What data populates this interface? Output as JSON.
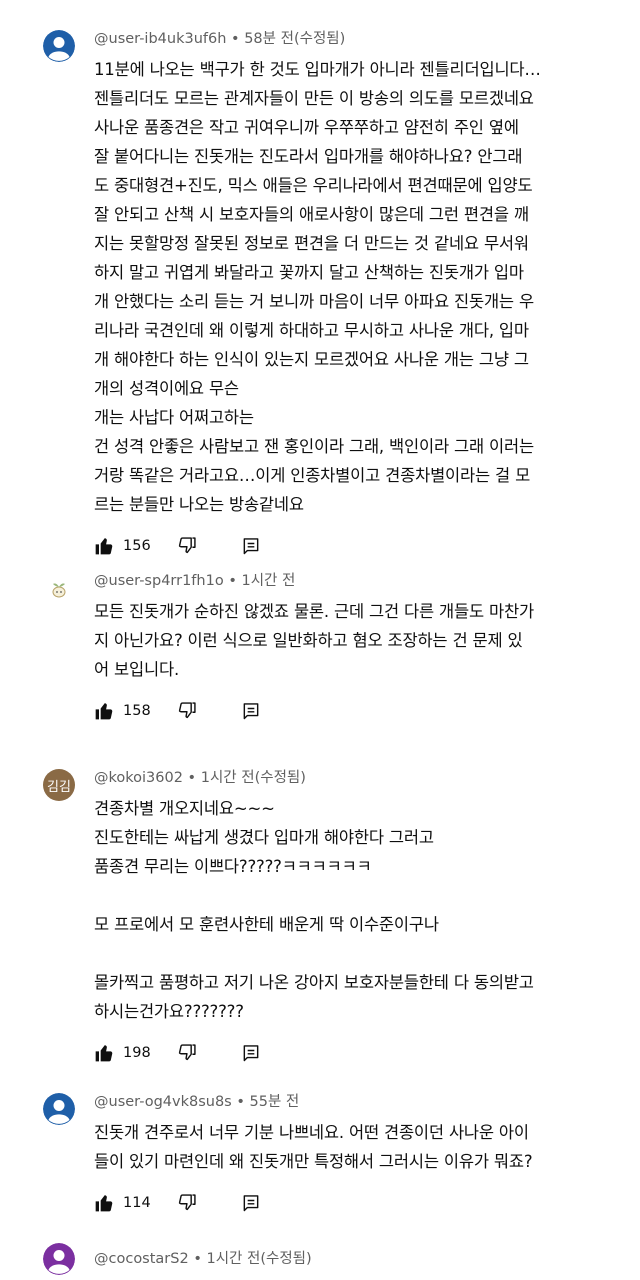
{
  "comments": [
    {
      "author": "@user-ib4uk3uf6h",
      "time": "58분 전(수정됨)",
      "avatar": "default-avatar-icon",
      "lines": [
        "11분에 나오는 백구가 한 것도 입마개가 아니라 젠틀리더입니다…",
        "젠틀리더도 모르는 관계자들이 만든 이 방송의 의도를 모르겠네요",
        "사나운 품종견은 작고 귀여우니까 우쭈쭈하고 얌전히 주인 옆에",
        "잘 붙어다니는 진돗개는 진도라서 입마개를 해야하나요? 안그래",
        "도 중대형견+진도, 믹스 애들은 우리나라에서 편견때문에 입양도",
        "잘 안되고 산책 시 보호자들의 애로사항이 많은데 그런 편견을 깨",
        "지는 못할망정 잘못된 정보로 편견을 더 만드는 것 같네요 무서워",
        "하지 말고 귀엽게 봐달라고 꽃까지 달고 산책하는 진돗개가 입마",
        "개 안했다는 소리 듣는 거 보니까 마음이 너무 아파요 진돗개는 우",
        "리나라 국견인데 왜 이렇게 하대하고 무시하고 사나운 개다, 입마",
        "개 해야한다 하는 인식이 있는지 모르겠어요 사나운 개는 그냥 그",
        "개의 성격이에요 무슨",
        "개는 사납다 어쩌고하는",
        "건 성격 안좋은 사람보고 잰 홍인이라 그래, 백인이라 그래 이러는",
        "거랑 똑같은 거라고요…이게 인종차별이고 견종차별이라는 걸 모",
        "르는 분들만 나오는 방송같네요"
      ],
      "likes": "156"
    },
    {
      "author": "@user-sp4rr1fh1o",
      "time": "1시간 전",
      "avatar": "sprout-avatar-icon",
      "lines": [
        "모든 진돗개가 순하진 않겠죠 물론. 근데 그건 다른 개들도 마찬가",
        "지 아닌가요? 이런 식으로 일반화하고 혐오 조장하는 건 문제 있",
        "어 보입니다."
      ],
      "likes": "158"
    },
    {
      "author": "@kokoi3602",
      "time": "1시간 전(수정됨)",
      "avatar_text": "김김",
      "avatar_color": "#8a6a45",
      "lines": [
        "견종차별 개오지네요~~~",
        "진도한테는 싸납게 생겼다 입마개 해야한다 그러고",
        "품종견 무리는 이쁘다?????ㅋㅋㅋㅋㅋㅋ",
        "",
        "모 프로에서 모 훈련사한테 배운게 딱 이수준이구나",
        "",
        "몰카찍고 품평하고 저기 나온 강아지 보호자분들한테 다 동의받고",
        "하시는건가요???????"
      ],
      "likes": "198"
    },
    {
      "author": "@user-og4vk8su8s",
      "time": "55분 전",
      "avatar": "default-avatar-icon",
      "lines": [
        "진돗개 견주로서 너무 기분 나쁘네요. 어떤 견종이던 사나운 아이",
        "들이 있기 마련인데 왜 진돗개만 특정해서 그러시는 이유가 뭐죠?"
      ],
      "likes": "114"
    },
    {
      "author": "@cocostarS2",
      "time": "1시간 전(수정됨)",
      "avatar": "default-avatar-icon"
    }
  ],
  "colors": {
    "avatar_blue": "#1f5fa8",
    "avatar_purple": "#7b2fa0",
    "avatar_brown": "#8a6a45",
    "meta_text": "#606060"
  },
  "icons": {
    "like": "thumbs-up-icon",
    "dislike": "thumbs-down-icon",
    "reply": "reply-icon",
    "menu": "more-vert-icon"
  }
}
